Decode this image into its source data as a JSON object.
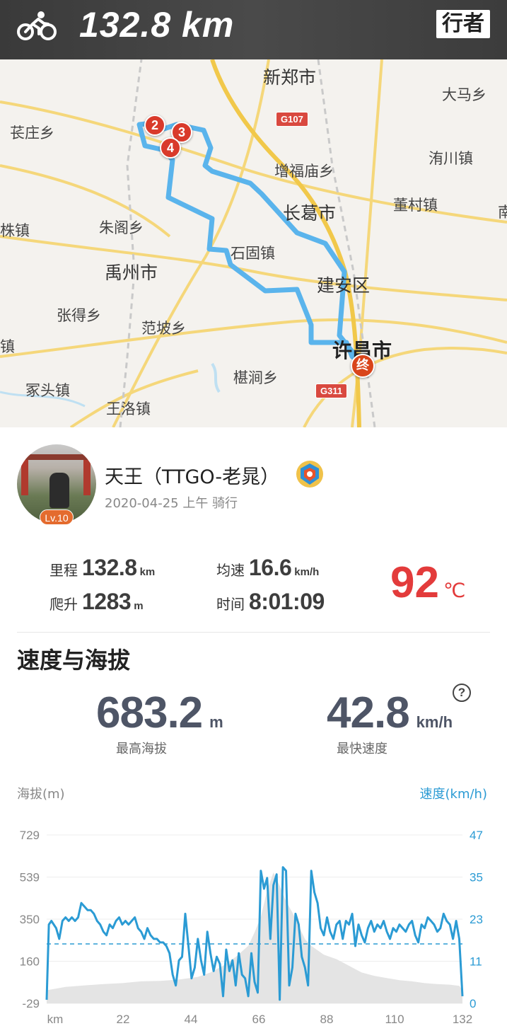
{
  "header": {
    "distance": "132.8 km",
    "brand": "行者",
    "icon": "bicycle-icon"
  },
  "map": {
    "labels": {
      "xinzheng": "新郑市",
      "damaxiang": "大马乡",
      "chuangzhuangxiang": "苌庄乡",
      "yuanchuanzhen": "洧川镇",
      "zengfumiaoxiang": "增福庙乡",
      "dongcunzhen": "董村镇",
      "changgeshi": "长葛市",
      "zhuzhen": "株镇",
      "zhugexiang": "朱阁乡",
      "shiguzhen": "石固镇",
      "yuzhoushi": "禹州市",
      "jiananqu": "建安区",
      "zhangdexiang": "张得乡",
      "fanpoxiang": "范坡乡",
      "xuchangshi": "许昌市",
      "zhen": "镇",
      "jiatouzhen": "冢头镇",
      "kanjianxiang": "椹涧乡",
      "wangluozhen": "王洛镇",
      "nan": "南"
    },
    "road_signs": {
      "g107": "G107",
      "g311": "G311"
    },
    "markers": [
      "2",
      "3",
      "4"
    ],
    "end_marker": "终",
    "route_color": "#5ab4ec"
  },
  "user": {
    "name": "天王（TTGO-老晁）",
    "meta": "2020-04-25 上午 骑行",
    "level": "Lv.10"
  },
  "stats": {
    "distance": {
      "label": "里程",
      "value": "132.8",
      "unit": "km"
    },
    "avg_speed": {
      "label": "均速",
      "value": "16.6",
      "unit": "km/h"
    },
    "climb": {
      "label": "爬升",
      "value": "1283",
      "unit": "m"
    },
    "time": {
      "label": "时间",
      "value": "8:01:09"
    },
    "temperature": {
      "value": "92",
      "unit": "℃",
      "color": "#e33b3b"
    }
  },
  "speed_section": {
    "title": "速度与海拔",
    "max_altitude": {
      "value": "683.2",
      "unit": "m",
      "caption": "最高海拔"
    },
    "max_speed": {
      "value": "42.8",
      "unit": "km/h",
      "caption": "最快速度"
    },
    "help": "?"
  },
  "chart_data": {
    "type": "line",
    "left_axis_label": "海拔(m)",
    "right_axis_label": "速度(km/h)",
    "left_ticks": [
      "729",
      "539",
      "350",
      "160",
      "-29"
    ],
    "right_ticks": [
      "47",
      "35",
      "23",
      "11",
      "0"
    ],
    "x_ticks": [
      "km",
      "22",
      "44",
      "66",
      "88",
      "110",
      "132"
    ],
    "ylim_left": [
      -29,
      729
    ],
    "ylim_right": [
      0,
      47
    ],
    "xlim": [
      0,
      132
    ],
    "average_speed": 16.6,
    "speed_color": "#2b9bd4",
    "altitude_fill": "#e4e4e4",
    "altitude": {
      "x": [
        0,
        6,
        12,
        18,
        24,
        30,
        36,
        42,
        48,
        52,
        56,
        60,
        64,
        66,
        68,
        70,
        72,
        74,
        76,
        78,
        80,
        82,
        84,
        86,
        88,
        92,
        96,
        100,
        104,
        108,
        112,
        116,
        120,
        124,
        128,
        131,
        132
      ],
      "y": [
        30,
        45,
        52,
        58,
        62,
        70,
        72,
        78,
        90,
        110,
        140,
        180,
        230,
        290,
        360,
        480,
        560,
        500,
        430,
        380,
        320,
        260,
        230,
        210,
        190,
        170,
        140,
        110,
        95,
        85,
        75,
        70,
        62,
        58,
        55,
        50,
        30
      ]
    },
    "speed": {
      "x": [
        0,
        0.7,
        1.5,
        3,
        4,
        5,
        6,
        7,
        8,
        9,
        10,
        11,
        12,
        13,
        14,
        15,
        16,
        17,
        18,
        19,
        20,
        21,
        22,
        23,
        24,
        25,
        26,
        27,
        28,
        29,
        30,
        31,
        32,
        33,
        34,
        35,
        36,
        37,
        38,
        39,
        40,
        41,
        42,
        43,
        44,
        45,
        46,
        47,
        48,
        49,
        50,
        51,
        52,
        53,
        54,
        55,
        56,
        57,
        58,
        59,
        60,
        61,
        62,
        63,
        64,
        65,
        66,
        67,
        68,
        69,
        70,
        71,
        72,
        73,
        74,
        75,
        76,
        77,
        78,
        79,
        80,
        81,
        82,
        83,
        84,
        85,
        86,
        87,
        88,
        89,
        90,
        91,
        92,
        93,
        94,
        95,
        96,
        97,
        98,
        99,
        100,
        101,
        102,
        103,
        104,
        105,
        106,
        107,
        108,
        109,
        110,
        111,
        112,
        113,
        114,
        115,
        116,
        117,
        118,
        119,
        120,
        121,
        122,
        123,
        124,
        125,
        126,
        127,
        128,
        129,
        130,
        131,
        132
      ],
      "y": [
        1,
        22,
        23,
        21,
        18,
        23,
        24,
        23,
        24,
        23,
        24,
        28,
        27,
        26,
        26,
        25,
        23,
        22,
        20,
        19,
        22,
        21,
        23,
        24,
        22,
        23,
        22,
        23,
        24,
        21,
        20,
        18,
        21,
        19,
        18,
        18,
        17,
        17,
        16,
        14,
        8,
        5,
        12,
        13,
        25,
        16,
        7,
        10,
        18,
        12,
        8,
        20,
        14,
        9,
        13,
        11,
        2,
        15,
        9,
        12,
        5,
        14,
        8,
        7,
        2,
        14,
        6,
        3,
        37,
        32,
        35,
        18,
        33,
        36,
        1,
        38,
        37,
        5,
        10,
        25,
        22,
        13,
        10,
        5,
        37,
        31,
        28,
        21,
        19,
        24,
        20,
        18,
        22,
        23,
        18,
        23,
        22,
        25,
        16,
        22,
        19,
        17,
        21,
        23,
        20,
        22,
        21,
        23,
        20,
        18,
        21,
        20,
        22,
        21,
        20,
        22,
        23,
        19,
        17,
        22,
        21,
        24,
        23,
        22,
        20,
        21,
        25,
        23,
        22,
        18,
        23,
        18,
        2
      ]
    }
  }
}
